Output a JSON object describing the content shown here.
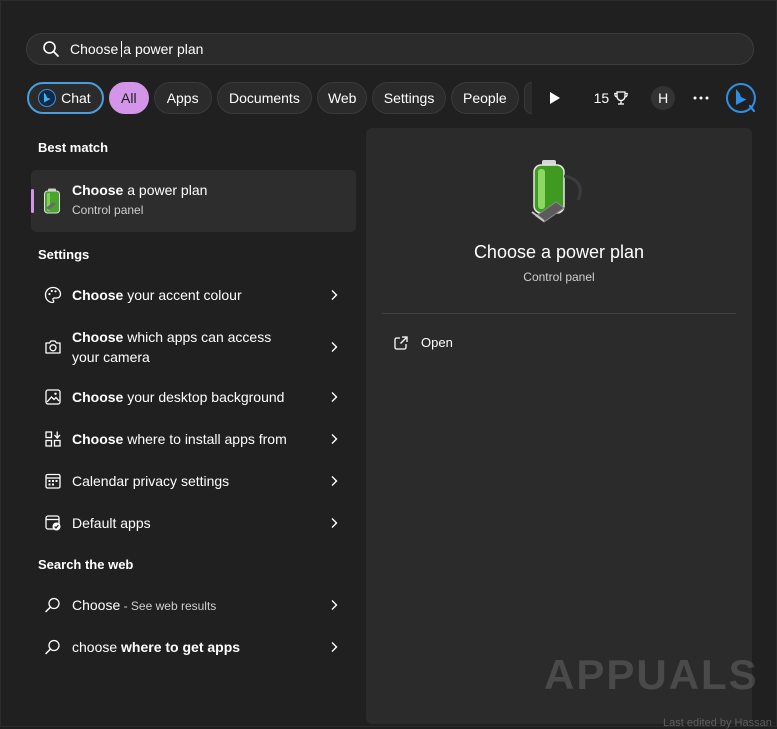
{
  "search": {
    "query_typed": "Choose",
    "query_rest": "a power plan"
  },
  "filters": {
    "chat": "Chat",
    "tabs": [
      "All",
      "Apps",
      "Documents",
      "Web",
      "Settings",
      "People"
    ],
    "points": "15",
    "avatar": "H"
  },
  "best_match": {
    "title": "Best match",
    "item": {
      "bold": "Choose",
      "rest": " a power plan",
      "subtitle": "Control panel"
    }
  },
  "settings": {
    "title": "Settings",
    "items": [
      {
        "bold": "Choose",
        "rest": " your accent colour"
      },
      {
        "bold": "Choose",
        "rest": " which apps can access",
        "line2": "your camera"
      },
      {
        "bold": "Choose",
        "rest": " your desktop background"
      },
      {
        "bold": "Choose",
        "rest": " where to install apps from"
      },
      {
        "bold": "",
        "rest": "Calendar privacy settings"
      },
      {
        "bold": "",
        "rest": "Default apps"
      }
    ]
  },
  "web": {
    "title": "Search the web",
    "items": [
      {
        "pre": "Choose",
        "sub": " - See web results"
      },
      {
        "pre": "choose ",
        "bold": "where to get apps"
      }
    ]
  },
  "preview": {
    "title": "Choose a power plan",
    "subtitle": "Control panel",
    "open_label": "Open"
  },
  "watermark": {
    "logo": "APPUALS",
    "credit": "Last edited by Hassan"
  },
  "colors": {
    "accent": "#d295e8",
    "chat_border": "#4a9ede",
    "panel": "#2b2b2b"
  }
}
